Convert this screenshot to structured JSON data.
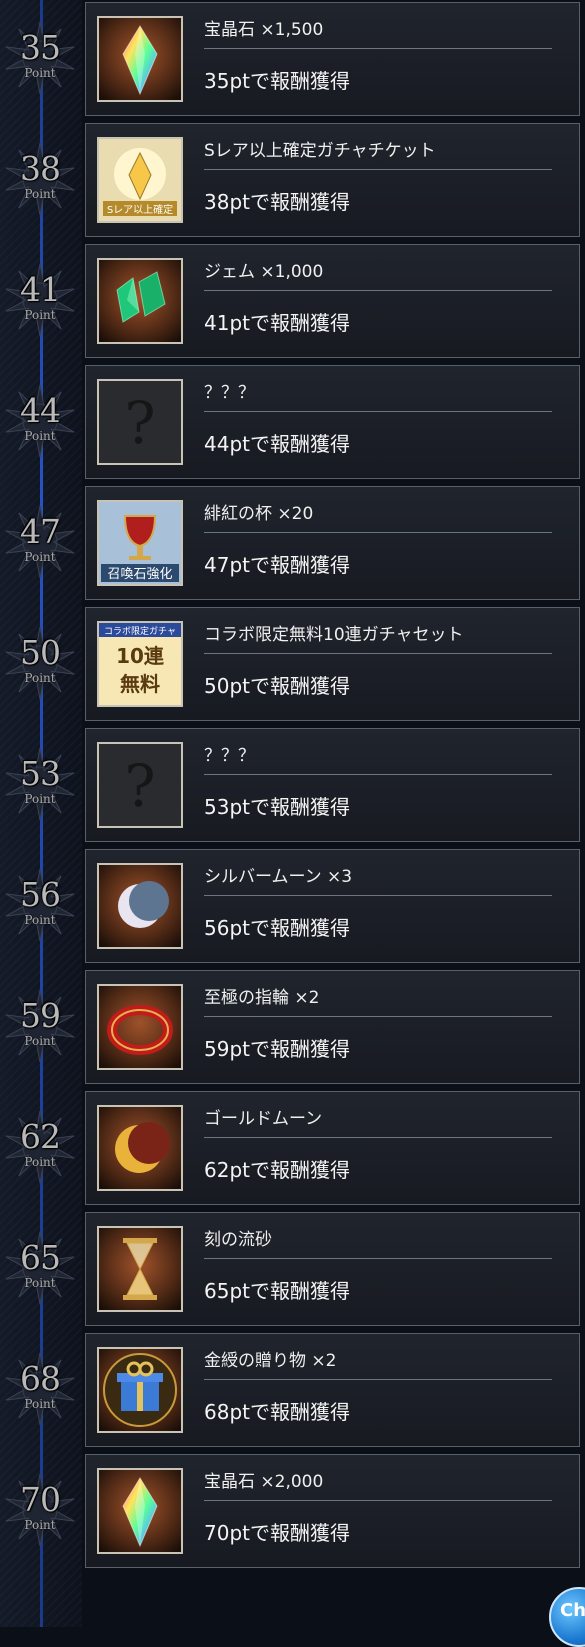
{
  "point_unit": "Point",
  "chat_button": {
    "label": "Ch"
  },
  "rewards": [
    {
      "points": "35",
      "name": "宝晶石 ×1,500",
      "condition": "35ptで報酬獲得",
      "icon": "crystal-icon",
      "color": "#b55a2a"
    },
    {
      "points": "38",
      "name": "Sレア以上確定ガチャチケット",
      "condition": "38ptで報酬獲得",
      "icon": "s-rare-ticket-icon",
      "color": "#d8c27a",
      "ticket_label": "Sレア以上確定"
    },
    {
      "points": "41",
      "name": "ジェム ×1,000",
      "condition": "41ptで報酬獲得",
      "icon": "gem-icon",
      "color": "#b55a2a"
    },
    {
      "points": "44",
      "name": "？？？",
      "condition": "44ptで報酬獲得",
      "icon": "mystery-icon",
      "color": "#2a2b2e"
    },
    {
      "points": "47",
      "name": "緋紅の杯 ×20",
      "condition": "47ptで報酬獲得",
      "icon": "crimson-chalice-icon",
      "color": "#6b8db5",
      "badge_label": "召喚石強化"
    },
    {
      "points": "50",
      "name": "コラボ限定無料10連ガチャセット",
      "condition": "50ptで報酬獲得",
      "icon": "collab-gacha-set-icon",
      "color": "#f0d98a",
      "ticket_top": "コラボ限定ガチャ",
      "ticket_mid": "10連",
      "ticket_bottom": "無料"
    },
    {
      "points": "53",
      "name": "？？？",
      "condition": "53ptで報酬獲得",
      "icon": "mystery-icon",
      "color": "#2a2b2e"
    },
    {
      "points": "56",
      "name": "シルバームーン ×3",
      "condition": "56ptで報酬獲得",
      "icon": "silver-moon-icon",
      "color": "#5d7590"
    },
    {
      "points": "59",
      "name": "至極の指輪 ×2",
      "condition": "59ptで報酬獲得",
      "icon": "supreme-ring-icon",
      "color": "#b55a2a"
    },
    {
      "points": "62",
      "name": "ゴールドムーン",
      "condition": "62ptで報酬獲得",
      "icon": "gold-moon-icon",
      "color": "#7a2418"
    },
    {
      "points": "65",
      "name": "刻の流砂",
      "condition": "65ptで報酬獲得",
      "icon": "hourglass-icon",
      "color": "#b55a2a"
    },
    {
      "points": "68",
      "name": "金綬の贈り物 ×2",
      "condition": "68ptで報酬獲得",
      "icon": "gift-box-icon",
      "color": "#6a4a1a"
    },
    {
      "points": "70",
      "name": "宝晶石 ×2,000",
      "condition": "70ptで報酬獲得",
      "icon": "crystal-icon",
      "color": "#b55a2a"
    }
  ]
}
